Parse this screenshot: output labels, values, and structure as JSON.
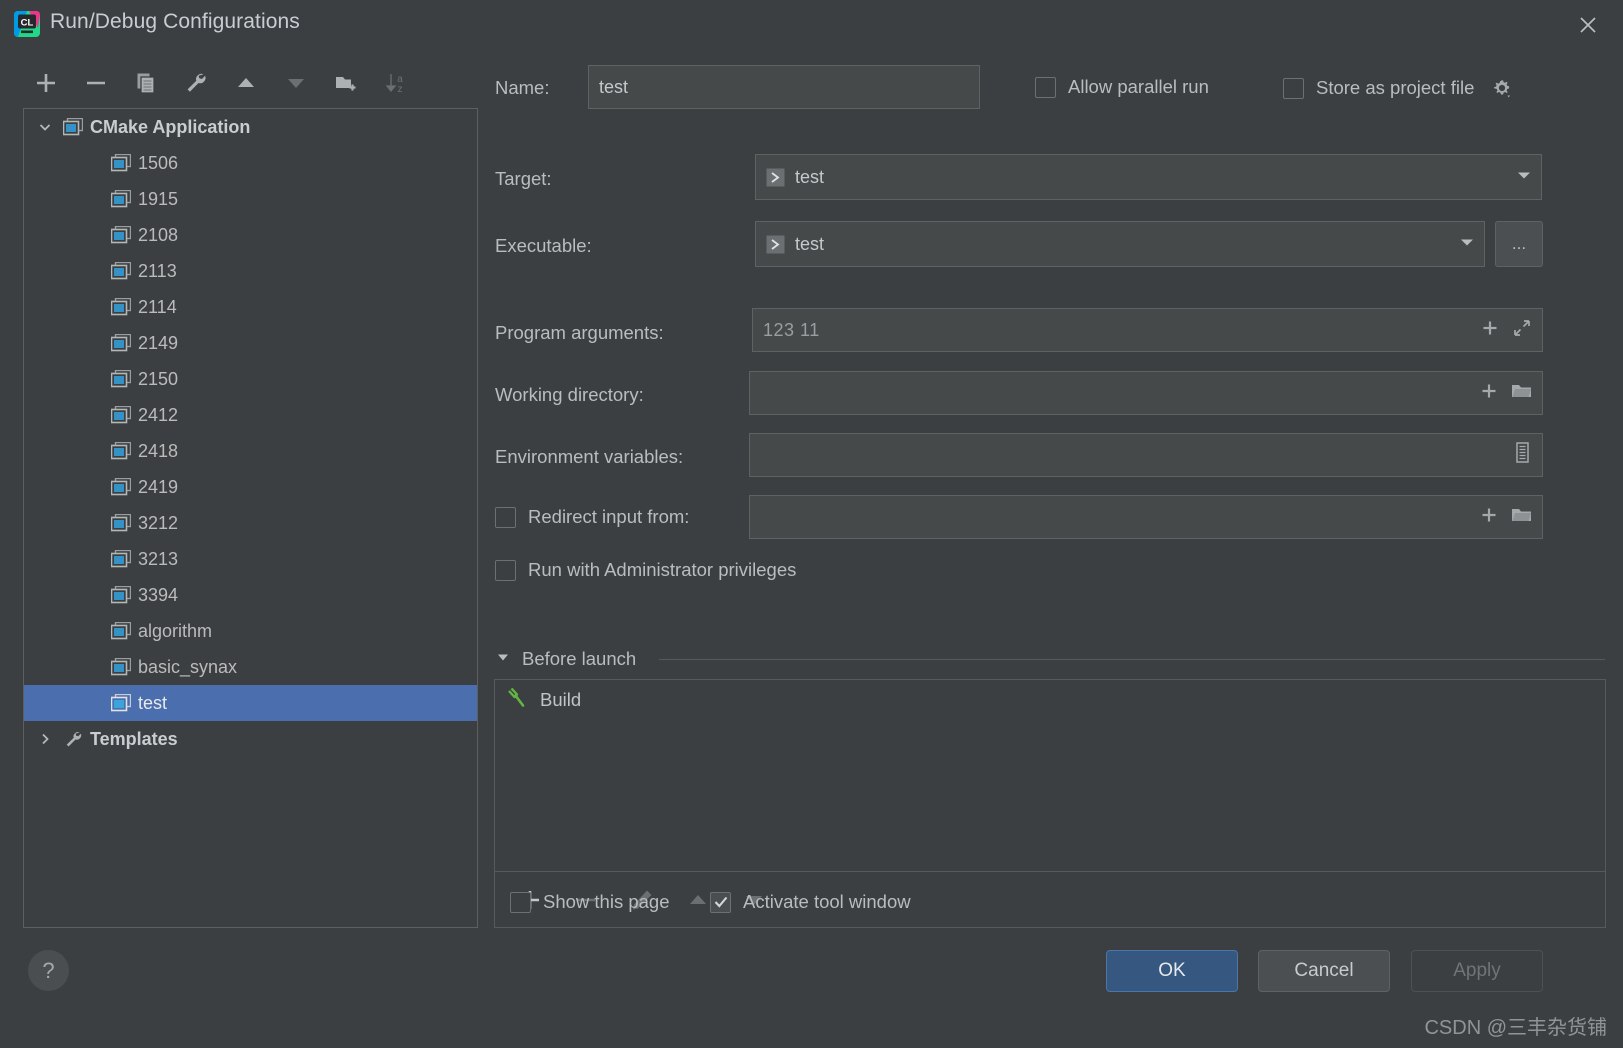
{
  "window": {
    "title": "Run/Debug Configurations",
    "close_label": "×",
    "logo_text": "CL"
  },
  "colors": {
    "background": "#3c3f41",
    "field_background": "#45494a",
    "selection_blue": "#4b6eaf",
    "primary_button": "#365880",
    "tree_icon_blue": "#3592c4",
    "build_icon_green": "#62b543",
    "border": "#5e6263"
  },
  "left_toolbar": {
    "buttons": [
      {
        "name": "add-configuration-button",
        "icon": "plus-icon",
        "enabled": true
      },
      {
        "name": "remove-configuration-button",
        "icon": "minus-icon",
        "enabled": true
      },
      {
        "name": "copy-configuration-button",
        "icon": "copy-icon",
        "enabled": true
      },
      {
        "name": "edit-templates-button",
        "icon": "wrench-icon",
        "enabled": true
      },
      {
        "name": "move-up-button",
        "icon": "arrow-up-icon",
        "enabled": true
      },
      {
        "name": "move-down-button",
        "icon": "arrow-down-icon",
        "enabled": false
      },
      {
        "name": "new-folder-button",
        "icon": "folder-add-icon",
        "enabled": true
      },
      {
        "name": "sort-configurations-button",
        "icon": "sort-az-icon",
        "enabled": false
      }
    ]
  },
  "tree": {
    "root": {
      "label": "CMake Application",
      "icon": "cmake-app-icon",
      "expanded": true
    },
    "children": [
      {
        "label": "1506",
        "icon": "run-config-icon",
        "selected": false
      },
      {
        "label": "1915",
        "icon": "run-config-icon",
        "selected": false
      },
      {
        "label": "2108",
        "icon": "run-config-icon",
        "selected": false
      },
      {
        "label": "2113",
        "icon": "run-config-icon",
        "selected": false
      },
      {
        "label": "2114",
        "icon": "run-config-icon",
        "selected": false
      },
      {
        "label": "2149",
        "icon": "run-config-icon",
        "selected": false
      },
      {
        "label": "2150",
        "icon": "run-config-icon",
        "selected": false
      },
      {
        "label": "2412",
        "icon": "run-config-icon",
        "selected": false
      },
      {
        "label": "2418",
        "icon": "run-config-icon",
        "selected": false
      },
      {
        "label": "2419",
        "icon": "run-config-icon",
        "selected": false
      },
      {
        "label": "3212",
        "icon": "run-config-icon",
        "selected": false
      },
      {
        "label": "3213",
        "icon": "run-config-icon",
        "selected": false
      },
      {
        "label": "3394",
        "icon": "run-config-icon",
        "selected": false
      },
      {
        "label": "algorithm",
        "icon": "run-config-icon",
        "selected": false
      },
      {
        "label": "basic_synax",
        "icon": "run-config-icon",
        "selected": false
      },
      {
        "label": "test",
        "icon": "run-config-icon",
        "selected": true
      }
    ],
    "templates": {
      "label": "Templates",
      "icon": "wrench-icon",
      "expanded": false
    }
  },
  "help_button": {
    "label": "?"
  },
  "form": {
    "name": {
      "label": "Name:",
      "value": "test"
    },
    "allow_parallel_run": {
      "label": "Allow parallel run",
      "checked": false
    },
    "store_as_project_file": {
      "label": "Store as project file",
      "checked": false,
      "gear_icon": "gear-icon"
    },
    "target": {
      "label": "Target:",
      "value": "test",
      "icon": "target-run-icon"
    },
    "executable": {
      "label": "Executable:",
      "value": "test",
      "icon": "target-run-icon",
      "browse_label": "..."
    },
    "program_arguments": {
      "label": "Program arguments:",
      "value": "123  11"
    },
    "working_directory": {
      "label": "Working directory:",
      "value": ""
    },
    "environment_variables": {
      "label": "Environment variables:",
      "value": ""
    },
    "redirect_input_from": {
      "label": "Redirect input from:",
      "checked": false,
      "value": ""
    },
    "run_with_admin": {
      "label": "Run with Administrator privileges",
      "checked": false
    }
  },
  "before_launch": {
    "title": "Before launch",
    "expanded": true,
    "items": [
      {
        "label": "Build",
        "icon": "hammer-icon"
      }
    ],
    "toolbar": [
      {
        "name": "add-task-button",
        "icon": "plus-icon",
        "enabled": true
      },
      {
        "name": "remove-task-button",
        "icon": "minus-icon",
        "enabled": false
      },
      {
        "name": "edit-task-button",
        "icon": "pencil-icon",
        "enabled": false
      },
      {
        "name": "move-task-up-button",
        "icon": "arrow-up-icon",
        "enabled": false
      },
      {
        "name": "move-task-down-button",
        "icon": "arrow-down-icon",
        "enabled": false
      }
    ],
    "show_this_page": {
      "label": "Show this page",
      "checked": false
    },
    "activate_tool_window": {
      "label": "Activate tool window",
      "checked": true
    }
  },
  "footer": {
    "ok": "OK",
    "cancel": "Cancel",
    "apply": "Apply",
    "watermark": "CSDN @三丰杂货铺"
  }
}
